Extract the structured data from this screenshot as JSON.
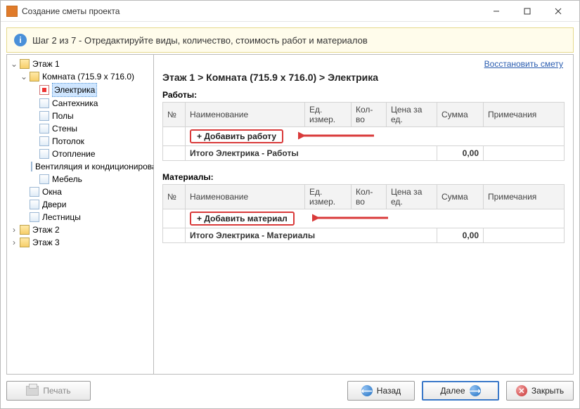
{
  "window": {
    "title": "Создание сметы проекта"
  },
  "info": {
    "text": "Шаг 2 из 7 - Отредактируйте виды, количество, стоимость работ и материалов"
  },
  "restore_link": "Восстановить смету",
  "breadcrumb": "Этаж 1 > Комната (715.9 x 716.0) > Электрика",
  "tree": {
    "floor1": "Этаж 1",
    "room": "Комната (715.9 x 716.0)",
    "items": {
      "electrics": "Электрика",
      "plumbing": "Сантехника",
      "floors": "Полы",
      "walls": "Стены",
      "ceiling": "Потолок",
      "heating": "Отопление",
      "ventilation": "Вентиляция и кондиционирование",
      "furniture": "Мебель"
    },
    "windows": "Окна",
    "doors": "Двери",
    "stairs": "Лестницы",
    "floor2": "Этаж 2",
    "floor3": "Этаж 3"
  },
  "sections": {
    "work": {
      "label": "Работы:",
      "add_label": "+ Добавить работу",
      "total_label": "Итого Электрика - Работы",
      "total_value": "0,00"
    },
    "materials": {
      "label": "Материалы:",
      "add_label": "+ Добавить материал",
      "total_label": "Итого Электрика - Материалы",
      "total_value": "0,00"
    }
  },
  "columns": {
    "no": "№",
    "name": "Наименование",
    "unit": "Ед. измер.",
    "qty": "Кол-во",
    "price": "Цена за ед.",
    "sum": "Сумма",
    "notes": "Примечания"
  },
  "footer": {
    "print": "Печать",
    "back": "Назад",
    "next": "Далее",
    "close": "Закрыть"
  }
}
